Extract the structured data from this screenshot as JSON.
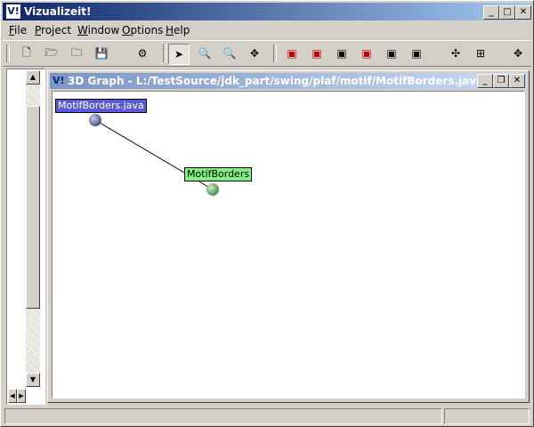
{
  "app": {
    "title": "Vizualizeit!",
    "logo": "V!"
  },
  "window_buttons": {
    "minimize": "_",
    "maximize": "□",
    "close": "✕"
  },
  "menu": [
    {
      "label": "File",
      "key": "F",
      "rest": "ile"
    },
    {
      "label": "Project",
      "key": "P",
      "rest": "roject"
    },
    {
      "label": "Window",
      "key": "W",
      "rest": "indow"
    },
    {
      "label": "Options",
      "key": "O",
      "rest": "ptions"
    },
    {
      "label": "Help",
      "key": "H",
      "rest": "elp"
    }
  ],
  "toolbar": {
    "icons": [
      "new-icon",
      "open-icon",
      "open-folder-icon",
      "save-icon",
      "build-icon",
      "pointer-icon",
      "zoom-in-icon",
      "zoom-out-icon",
      "pan-icon",
      "cube-red-1-icon",
      "cube-red-2-icon",
      "cube-1-icon",
      "cube-2-icon",
      "cube-3-icon",
      "cube-4-icon",
      "spread-icon",
      "grid-icon",
      "move-icon"
    ],
    "glyphs": {
      "new": "🗋",
      "open": "🗁",
      "open2": "🗀",
      "save": "💾",
      "build": "⚙",
      "pointer": "➤",
      "zin": "🔍",
      "zout": "🔍",
      "pan": "✥",
      "cube": "▣",
      "spread": "✣",
      "grid": "⊞",
      "move": "✥"
    }
  },
  "graph_window": {
    "logo": "V!",
    "title": "3D Graph - L:/TestSource/jdk_part/swing/plaf/motif/MotifBorders.java",
    "buttons": {
      "minimize": "_",
      "restore": "❐",
      "close": "✕"
    }
  },
  "graph": {
    "nodes": [
      {
        "label": "MotifBorders.java",
        "label_bg": "#5a5ad6",
        "label_fg": "#ffffff",
        "node_color": "#6b73a6"
      },
      {
        "label": "MotifBorders",
        "label_bg": "#80f080",
        "label_fg": "#000000",
        "node_color": "#6aa86a"
      }
    ],
    "edges": [
      {
        "from": 0,
        "to": 1
      }
    ]
  },
  "colors": {
    "titlebar_start": "#0a246a",
    "titlebar_end": "#a6caf0",
    "chrome": "#d4d0c8"
  }
}
